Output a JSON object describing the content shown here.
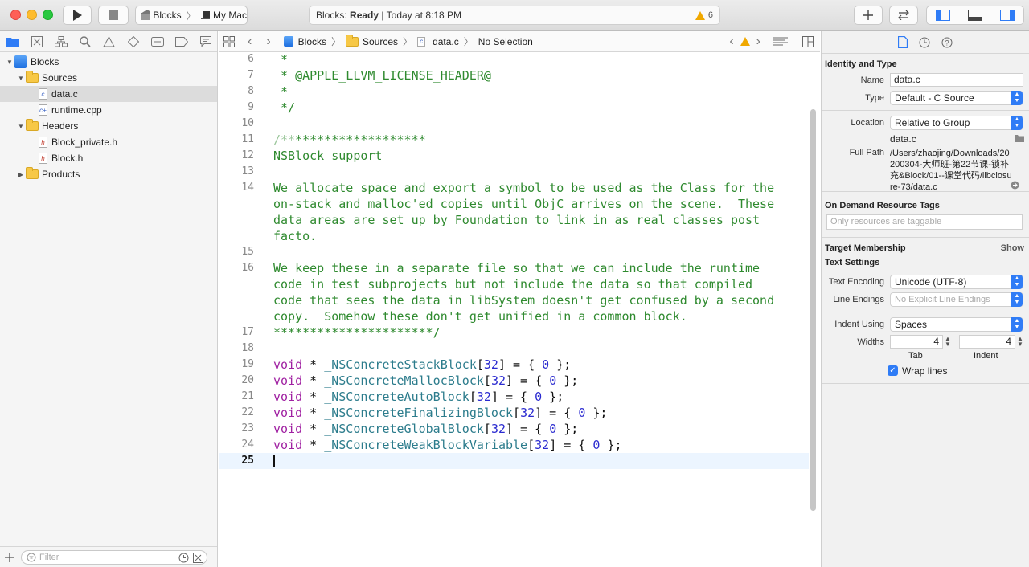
{
  "toolbar": {
    "scheme_project": "Blocks",
    "scheme_destination": "My Mac",
    "activity_project": "Blocks:",
    "activity_status": "Ready",
    "activity_time": "| Today at 8:18 PM",
    "warning_count": "6"
  },
  "navigator": {
    "tree": [
      {
        "label": "Blocks",
        "kind": "project",
        "depth": 0,
        "expanded": true
      },
      {
        "label": "Sources",
        "kind": "folder",
        "depth": 1,
        "expanded": true
      },
      {
        "label": "data.c",
        "kind": "c",
        "depth": 2,
        "selected": true
      },
      {
        "label": "runtime.cpp",
        "kind": "cpp",
        "depth": 2
      },
      {
        "label": "Headers",
        "kind": "folder",
        "depth": 1,
        "expanded": true
      },
      {
        "label": "Block_private.h",
        "kind": "h",
        "depth": 2
      },
      {
        "label": "Block.h",
        "kind": "h",
        "depth": 2
      },
      {
        "label": "Products",
        "kind": "folder",
        "depth": 1,
        "expanded": false
      }
    ],
    "filter_placeholder": "Filter"
  },
  "jumpbar": {
    "project": "Blocks",
    "group": "Sources",
    "file": "data.c",
    "symbol": "No Selection"
  },
  "editor": {
    "lines": [
      {
        "n": "6",
        "parts": [
          [
            "c",
            " *"
          ]
        ]
      },
      {
        "n": "7",
        "parts": [
          [
            "c",
            " * @APPLE_LLVM_LICENSE_HEADER@"
          ]
        ]
      },
      {
        "n": "8",
        "parts": [
          [
            "c",
            " *"
          ]
        ]
      },
      {
        "n": "9",
        "parts": [
          [
            "c",
            " */"
          ]
        ]
      },
      {
        "n": "10",
        "parts": []
      },
      {
        "n": "11",
        "parts": [
          [
            "cf",
            "/**"
          ],
          [
            "c",
            "******************"
          ]
        ]
      },
      {
        "n": "12",
        "parts": [
          [
            "c",
            "NSBlock support"
          ]
        ]
      },
      {
        "n": "13",
        "parts": []
      },
      {
        "n": "14",
        "parts": [
          [
            "c",
            "We allocate space and export a symbol to be used as the Class for the"
          ]
        ]
      },
      {
        "n": "",
        "parts": [
          [
            "c",
            "on-stack and malloc'ed copies until ObjC arrives on the scene.  These"
          ]
        ]
      },
      {
        "n": "",
        "parts": [
          [
            "c",
            "data areas are set up by Foundation to link in as real classes post"
          ]
        ]
      },
      {
        "n": "",
        "parts": [
          [
            "c",
            "facto."
          ]
        ]
      },
      {
        "n": "15",
        "parts": []
      },
      {
        "n": "16",
        "parts": [
          [
            "c",
            "We keep these in a separate file so that we can include the runtime"
          ]
        ]
      },
      {
        "n": "",
        "parts": [
          [
            "c",
            "code in test subprojects but not include the data so that compiled"
          ]
        ]
      },
      {
        "n": "",
        "parts": [
          [
            "c",
            "code that sees the data in libSystem doesn't get confused by a second"
          ]
        ]
      },
      {
        "n": "",
        "parts": [
          [
            "c",
            "copy.  Somehow these don't get unified in a common block."
          ]
        ]
      },
      {
        "n": "17",
        "parts": [
          [
            "c",
            "**********************/"
          ]
        ]
      },
      {
        "n": "18",
        "parts": []
      },
      {
        "n": "19",
        "parts": [
          [
            "k",
            "void"
          ],
          [
            "p",
            " * "
          ],
          [
            "i",
            "_NSConcreteStackBlock"
          ],
          [
            "p",
            "["
          ],
          [
            "n",
            "32"
          ],
          [
            "p",
            "] = { "
          ],
          [
            "n",
            "0"
          ],
          [
            "p",
            " };"
          ]
        ]
      },
      {
        "n": "20",
        "parts": [
          [
            "k",
            "void"
          ],
          [
            "p",
            " * "
          ],
          [
            "i",
            "_NSConcreteMallocBlock"
          ],
          [
            "p",
            "["
          ],
          [
            "n",
            "32"
          ],
          [
            "p",
            "] = { "
          ],
          [
            "n",
            "0"
          ],
          [
            "p",
            " };"
          ]
        ]
      },
      {
        "n": "21",
        "parts": [
          [
            "k",
            "void"
          ],
          [
            "p",
            " * "
          ],
          [
            "i",
            "_NSConcreteAutoBlock"
          ],
          [
            "p",
            "["
          ],
          [
            "n",
            "32"
          ],
          [
            "p",
            "] = { "
          ],
          [
            "n",
            "0"
          ],
          [
            "p",
            " };"
          ]
        ]
      },
      {
        "n": "22",
        "parts": [
          [
            "k",
            "void"
          ],
          [
            "p",
            " * "
          ],
          [
            "i",
            "_NSConcreteFinalizingBlock"
          ],
          [
            "p",
            "["
          ],
          [
            "n",
            "32"
          ],
          [
            "p",
            "] = { "
          ],
          [
            "n",
            "0"
          ],
          [
            "p",
            " };"
          ]
        ]
      },
      {
        "n": "23",
        "parts": [
          [
            "k",
            "void"
          ],
          [
            "p",
            " * "
          ],
          [
            "i",
            "_NSConcreteGlobalBlock"
          ],
          [
            "p",
            "["
          ],
          [
            "n",
            "32"
          ],
          [
            "p",
            "] = { "
          ],
          [
            "n",
            "0"
          ],
          [
            "p",
            " };"
          ]
        ]
      },
      {
        "n": "24",
        "parts": [
          [
            "k",
            "void"
          ],
          [
            "p",
            " * "
          ],
          [
            "i",
            "_NSConcreteWeakBlockVariable"
          ],
          [
            "p",
            "["
          ],
          [
            "n",
            "32"
          ],
          [
            "p",
            "] = { "
          ],
          [
            "n",
            "0"
          ],
          [
            "p",
            " };"
          ]
        ]
      },
      {
        "n": "25",
        "parts": [],
        "current": true
      }
    ]
  },
  "inspector": {
    "identity_title": "Identity and Type",
    "name_label": "Name",
    "name_value": "data.c",
    "type_label": "Type",
    "type_value": "Default - C Source",
    "location_label": "Location",
    "location_value": "Relative to Group",
    "location_file": "data.c",
    "fullpath_label": "Full Path",
    "fullpath_value": "/Users/zhaojing/Downloads/20200304-大师班-第22节课-锁补充&Block/01--课堂代码/libclosure-73/data.c",
    "odr_title": "On Demand Resource Tags",
    "odr_placeholder": "Only resources are taggable",
    "membership_title": "Target Membership",
    "membership_show": "Show",
    "text_settings_title": "Text Settings",
    "encoding_label": "Text Encoding",
    "encoding_value": "Unicode (UTF-8)",
    "endings_label": "Line Endings",
    "endings_value": "No Explicit Line Endings",
    "indent_label": "Indent Using",
    "indent_value": "Spaces",
    "widths_label": "Widths",
    "tab_width": "4",
    "indent_width": "4",
    "tab_caption": "Tab",
    "indent_caption": "Indent",
    "wrap_label": "Wrap lines",
    "wrap_checked": true
  },
  "colors": {
    "accent": "#2f7cf6",
    "comment": "#2f8a2f",
    "keyword": "#a021a2",
    "identifier": "#2c7c8c",
    "number": "#2b2bd0",
    "warning": "#f0a800"
  }
}
